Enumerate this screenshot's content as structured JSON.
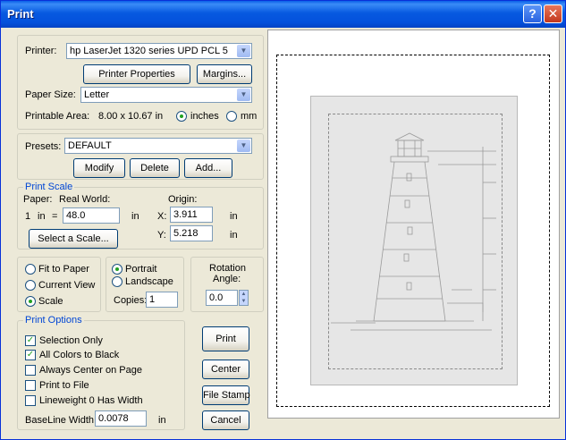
{
  "window": {
    "title": "Print"
  },
  "printer": {
    "label": "Printer:",
    "value": "hp LaserJet 1320 series UPD PCL 5",
    "properties_button": "Printer Properties",
    "margins_button": "Margins...",
    "paper_size_label": "Paper Size:",
    "paper_size_value": "Letter",
    "printable_area_label": "Printable Area:",
    "printable_area_value": "8.00 x 10.67 in",
    "unit_inches": "inches",
    "unit_mm": "mm",
    "selected_unit": "inches"
  },
  "presets": {
    "label": "Presets:",
    "value": "DEFAULT",
    "modify_button": "Modify",
    "delete_button": "Delete",
    "add_button": "Add..."
  },
  "print_scale": {
    "title": "Print Scale",
    "paper_label": "Paper:",
    "real_world_label": "Real World:",
    "origin_label": "Origin:",
    "paper_value": "1",
    "paper_unit": "in",
    "equals": "=",
    "real_world_value": "48.0",
    "real_world_unit": "in",
    "x_label": "X:",
    "x_value": "3.911",
    "x_unit": "in",
    "y_label": "Y:",
    "y_value": "5.218",
    "y_unit": "in",
    "select_scale_button": "Select a Scale..."
  },
  "fit": {
    "fit_to_paper": "Fit to Paper",
    "current_view": "Current View",
    "scale": "Scale",
    "selected": "Scale"
  },
  "orientation": {
    "portrait": "Portrait",
    "landscape": "Landscape",
    "selected": "Portrait",
    "copies_label": "Copies:",
    "copies_value": "1"
  },
  "rotation": {
    "label_line1": "Rotation",
    "label_line2": "Angle:",
    "value": "0.0"
  },
  "print_options": {
    "title": "Print Options",
    "options": [
      {
        "label": "Selection Only",
        "checked": true
      },
      {
        "label": "All Colors to Black",
        "checked": true
      },
      {
        "label": "Always Center on Page",
        "checked": false
      },
      {
        "label": "Print to File",
        "checked": false
      },
      {
        "label": "Lineweight 0 Has Width",
        "checked": false
      }
    ],
    "baseline_label": "BaseLine Width:",
    "baseline_value": "0.0078",
    "baseline_unit": "in"
  },
  "actions": {
    "print": "Print",
    "center": "Center",
    "file_stamp": "File Stamp",
    "cancel": "Cancel"
  },
  "icons": {
    "combo": "chevron-down-icon",
    "check": "checkmark-icon",
    "spin": "spin-arrows-icon"
  },
  "colors": {
    "titlebar": "#0a5fe8",
    "dialog": "#ece9d8",
    "group_title": "#0046d5",
    "radio_dot": "#21a121"
  }
}
